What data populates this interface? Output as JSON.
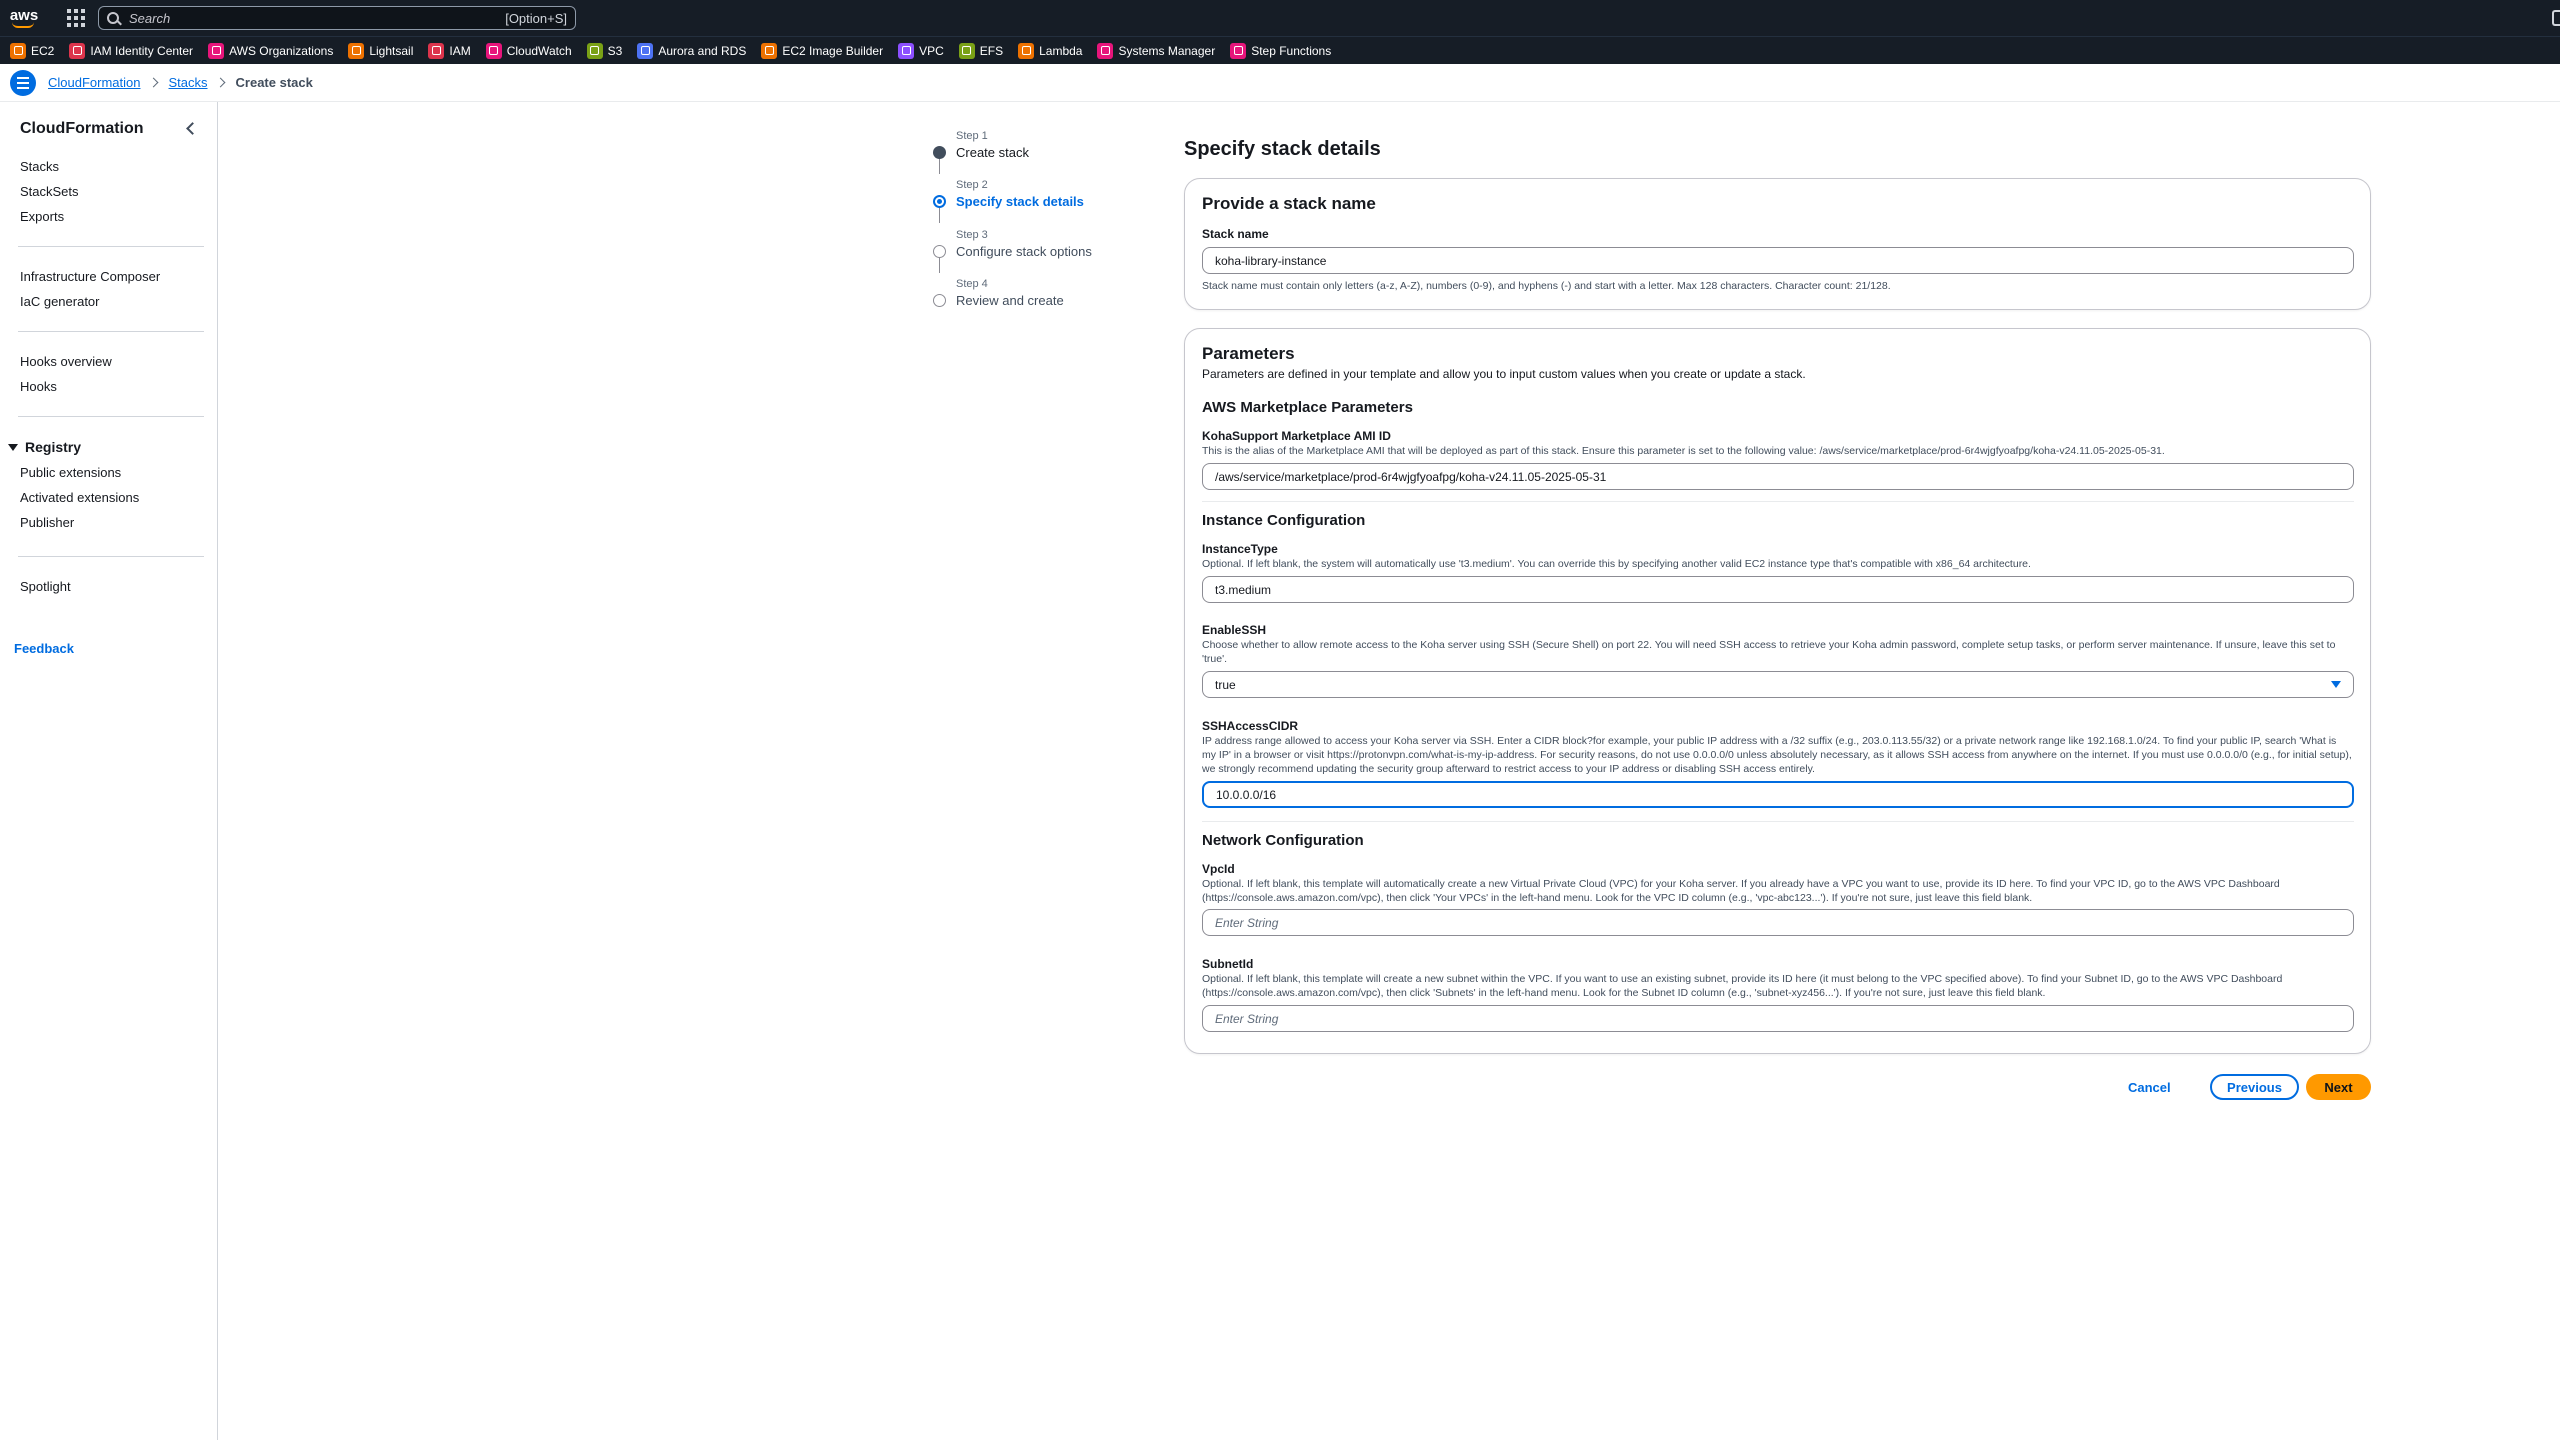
{
  "topnav": {
    "logo": "aws",
    "search_placeholder": "Search",
    "search_shortcut": "[Option+S]"
  },
  "favorites": [
    {
      "label": "EC2",
      "color": "#ed7100"
    },
    {
      "label": "IAM Identity Center",
      "color": "#dd344c"
    },
    {
      "label": "AWS Organizations",
      "color": "#e7157b"
    },
    {
      "label": "Lightsail",
      "color": "#ed7100"
    },
    {
      "label": "IAM",
      "color": "#dd344c"
    },
    {
      "label": "CloudWatch",
      "color": "#e7157b"
    },
    {
      "label": "S3",
      "color": "#7aa116"
    },
    {
      "label": "Aurora and RDS",
      "color": "#4d72f3"
    },
    {
      "label": "EC2 Image Builder",
      "color": "#ed7100"
    },
    {
      "label": "VPC",
      "color": "#8c4fff"
    },
    {
      "label": "EFS",
      "color": "#7aa116"
    },
    {
      "label": "Lambda",
      "color": "#ed7100"
    },
    {
      "label": "Systems Manager",
      "color": "#e7157b"
    },
    {
      "label": "Step Functions",
      "color": "#e7157b"
    }
  ],
  "breadcrumb": {
    "items": [
      "CloudFormation",
      "Stacks"
    ],
    "current": "Create stack"
  },
  "sidebar": {
    "title": "CloudFormation",
    "group1": [
      "Stacks",
      "StackSets",
      "Exports"
    ],
    "group2": [
      "Infrastructure Composer",
      "IaC generator"
    ],
    "group3": [
      "Hooks overview",
      "Hooks"
    ],
    "registry_title": "Registry",
    "registry": [
      "Public extensions",
      "Activated extensions",
      "Publisher"
    ],
    "group5": [
      "Spotlight"
    ],
    "feedback": "Feedback"
  },
  "steps": [
    {
      "num": "Step 1",
      "label": "Create stack",
      "state": "done"
    },
    {
      "num": "Step 2",
      "label": "Specify stack details",
      "state": "active"
    },
    {
      "num": "Step 3",
      "label": "Configure stack options",
      "state": "todo"
    },
    {
      "num": "Step 4",
      "label": "Review and create",
      "state": "todo"
    }
  ],
  "main": {
    "title": "Specify stack details",
    "stack_card": {
      "heading": "Provide a stack name",
      "label": "Stack name",
      "value": "koha-library-instance",
      "hint": "Stack name must contain only letters (a-z, A-Z), numbers (0-9), and hyphens (-) and start with a letter. Max 128 characters. Character count: 21/128."
    },
    "params_card": {
      "heading": "Parameters",
      "desc": "Parameters are defined in your template and allow you to input custom values when you create or update a stack.",
      "marketplace": {
        "heading": "AWS Marketplace Parameters",
        "label": "KohaSupport Marketplace AMI ID",
        "desc": "This is the alias of the Marketplace AMI that will be deployed as part of this stack. Ensure this parameter is set to the following value: /aws/service/marketplace/prod-6r4wjgfyoafpg/koha-v24.11.05-2025-05-31.",
        "value": "/aws/service/marketplace/prod-6r4wjgfyoafpg/koha-v24.11.05-2025-05-31"
      },
      "instance": {
        "heading": "Instance Configuration",
        "type_label": "InstanceType",
        "type_desc": "Optional. If left blank, the system will automatically use 't3.medium'. You can override this by specifying another valid EC2 instance type that's compatible with x86_64 architecture.",
        "type_value": "t3.medium",
        "ssh_label": "EnableSSH",
        "ssh_desc": "Choose whether to allow remote access to the Koha server using SSH (Secure Shell) on port 22. You will need SSH access to retrieve your Koha admin password, complete setup tasks, or perform server maintenance. If unsure, leave this set to 'true'.",
        "ssh_value": "true",
        "cidr_label": "SSHAccessCIDR",
        "cidr_desc": "IP address range allowed to access your Koha server via SSH. Enter a CIDR block?for example, your public IP address with a /32 suffix (e.g., 203.0.113.55/32) or a private network range like 192.168.1.0/24. To find your public IP, search 'What is my IP' in a browser or visit https://protonvpn.com/what-is-my-ip-address. For security reasons, do not use 0.0.0.0/0 unless absolutely necessary, as it allows SSH access from anywhere on the internet. If you must use 0.0.0.0/0 (e.g., for initial setup), we strongly recommend updating the security group afterward to restrict access to your IP address or disabling SSH access entirely.",
        "cidr_value": "10.0.0.0/16"
      },
      "network": {
        "heading": "Network Configuration",
        "vpc_label": "VpcId",
        "vpc_desc": "Optional. If left blank, this template will automatically create a new Virtual Private Cloud (VPC) for your Koha server. If you already have a VPC you want to use, provide its ID here. To find your VPC ID, go to the AWS VPC Dashboard (https://console.aws.amazon.com/vpc), then click 'Your VPCs' in the left-hand menu. Look for the VPC ID column (e.g., 'vpc-abc123...'). If you're not sure, just leave this field blank.",
        "vpc_placeholder": "Enter String",
        "subnet_label": "SubnetId",
        "subnet_desc": "Optional. If left blank, this template will create a new subnet within the VPC. If you want to use an existing subnet, provide its ID here (it must belong to the VPC specified above). To find your Subnet ID, go to the AWS VPC Dashboard (https://console.aws.amazon.com/vpc), then click 'Subnets' in the left-hand menu. Look for the Subnet ID column (e.g., 'subnet-xyz456...'). If you're not sure, just leave this field blank.",
        "subnet_placeholder": "Enter String"
      }
    },
    "actions": {
      "cancel": "Cancel",
      "previous": "Previous",
      "next": "Next"
    }
  }
}
